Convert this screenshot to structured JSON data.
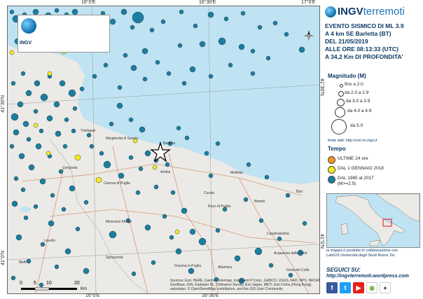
{
  "map": {
    "ticks_top": [
      "16°0'E",
      "16°30'E",
      "17°0'E"
    ],
    "ticks_bottom": [
      "16°0'E",
      "16°30'E"
    ],
    "ticks_left": [
      "41°30'N",
      "41°0'N"
    ],
    "ticks_right": [
      "41°30'N",
      "41°0'N"
    ],
    "small_logo_label": "INGV",
    "north_letter": "N",
    "scale": {
      "labels": [
        "0",
        "5",
        "10",
        "20"
      ],
      "unit": "Km"
    },
    "credits": "Sources: Esri, HERE, Garmin, Intermap, increment P Corp., GEBCO, USGS, FAO, NPS, NRCAN, GeoBase, IGN, Kadaster NL, Ordnance Survey, Esri Japan, METI, Esri China (Hong Kong), swisstopo, © OpenStreetMap contributors, and the GIS User Community",
    "places": {
      "trinitapoli": "Trinitapoli",
      "margherita": "Margherita di Savoia",
      "cerignola": "Cerignola",
      "barletta": "Barletta",
      "andria": "Andria",
      "molfetta": "Molfetta",
      "bari": "Bari",
      "corato": "Corato",
      "canosa": "Canosa di Puglia",
      "spinazzola": "Spinazzola",
      "minervino": "Minervino Murge",
      "gravina": "Gravina in Puglia",
      "altamura": "Altamura",
      "lavello": "Lavello",
      "melfi": "Melfi",
      "bitonto": "Bitonto",
      "acquaviva": "Acquaviva delle Fonti",
      "gioia": "Gioia del Colle",
      "casamassima": "Casamassima",
      "ruvo": "Ruvo di Puglia"
    },
    "colors": {
      "sea": "#bfe3f3",
      "land": "#eceae6",
      "historic": "#1a7fa0",
      "year": "#f5ec1e",
      "recent": "#f49a1f"
    }
  },
  "header": {
    "logo_main": "INGV",
    "logo_tail": "terremoti",
    "event_lines": [
      "EVENTO SISMICO DI ML 3.9",
      "A 4 km SE Barletta (BT)",
      "DEL 21/05/2019",
      "ALLE ORE 08:13:33 (UTC)",
      "A 34,2 Km DI PROFONDITA'"
    ]
  },
  "legend": {
    "magnitude_title": "Magnitudo (M)",
    "magnitude_classes": [
      "fino a 2.0",
      "da 2.0 a 2.9",
      "da 3.0 a 3.9",
      "da 4.0 a 4.9",
      "da 5.0"
    ],
    "source": "fonte dati: http://cnt.rm.ingv.it",
    "tempo_title": "Tempo",
    "tempo_items": [
      {
        "label": "ULTIME 24 ore",
        "color": "#f49a1f"
      },
      {
        "label": "DAL 1 GENNAIO 2018",
        "color": "#f5ec1e"
      },
      {
        "label": "DAL 1985 al 2017",
        "label2": "(M>=2.5)",
        "color": "#1a7fa0"
      }
    ]
  },
  "footer": {
    "collab_line1": "la mappa è prodotta in collaborazione con",
    "collab_line2": "LabGIS Università degli Studi Roma Tre",
    "follow": "SEGUICI SU:",
    "blog": "http://ingvterremoti.wordpress.com",
    "social_icons": [
      "facebook-icon",
      "twitter-icon",
      "youtube-icon",
      "android-app-icon",
      "ios-app-icon"
    ]
  }
}
